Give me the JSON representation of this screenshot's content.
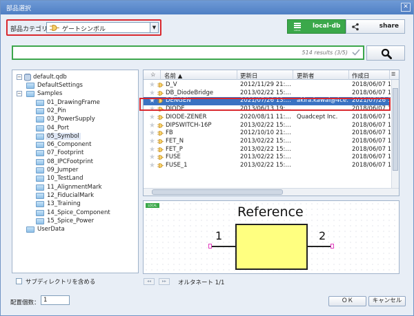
{
  "window": {
    "title": "部品選択",
    "close_glyph": "✕"
  },
  "category": {
    "label": "部品カテゴリ",
    "value": "ゲートシンボル"
  },
  "db": {
    "local_label": "local-db",
    "local_icon_tag": "LOCAL",
    "share_label": "share"
  },
  "search": {
    "value": "",
    "results": "514 results (3/5)"
  },
  "tree": {
    "root": "default.qdb",
    "items": [
      {
        "label": "DefaultSettings",
        "level": 1
      },
      {
        "label": "Samples",
        "level": 1
      },
      {
        "label": "01_DrawingFrame",
        "level": 2
      },
      {
        "label": "02_Pin",
        "level": 2
      },
      {
        "label": "03_PowerSupply",
        "level": 2
      },
      {
        "label": "04_Port",
        "level": 2
      },
      {
        "label": "05_Symbol",
        "level": 2,
        "selected": true
      },
      {
        "label": "06_Component",
        "level": 2
      },
      {
        "label": "07_Footprint",
        "level": 2
      },
      {
        "label": "08_IPCFootprint",
        "level": 2
      },
      {
        "label": "09_Jumper",
        "level": 2
      },
      {
        "label": "10_TestLand",
        "level": 2
      },
      {
        "label": "11_AlignmentMark",
        "level": 2
      },
      {
        "label": "12_FiducialMark",
        "level": 2
      },
      {
        "label": "13_Training",
        "level": 2
      },
      {
        "label": "14_Spice_Component",
        "level": 2
      },
      {
        "label": "15_Spice_Power",
        "level": 2
      },
      {
        "label": "UserData",
        "level": 1
      }
    ]
  },
  "include_subdirs": "サブディレクトリを含める",
  "grid": {
    "columns": {
      "star": "☆",
      "name": "名前 ▲",
      "updated": "更新日",
      "updater": "更新者",
      "created": "作成日"
    },
    "rows": [
      {
        "name": "D_V",
        "updated": "2012/11/29 21:…",
        "updater": "",
        "created": "2018/06/07 1"
      },
      {
        "name": "DB_DiodeBridge",
        "updated": "2013/02/22 15:…",
        "updater": "",
        "created": "2018/06/07 1"
      },
      {
        "name": "DENGEN",
        "updated": "2021/07/26 13:…",
        "updater": "akira.kawai@4ce…",
        "created": "2021/07/26 1",
        "selected": true
      },
      {
        "name": "DIODE",
        "updated": "2013/06/13 19:…",
        "updater": "",
        "created": "2018/06/07 1"
      },
      {
        "name": "DIODE-ZENER",
        "updated": "2020/08/11 11:…",
        "updater": "Quadcept Inc.",
        "created": "2018/06/07 1"
      },
      {
        "name": "DIPSWITCH-16P",
        "updated": "2013/02/22 15:…",
        "updater": "",
        "created": "2018/06/07 1"
      },
      {
        "name": "FB",
        "updated": "2012/10/10 21:…",
        "updater": "",
        "created": "2018/06/07 1"
      },
      {
        "name": "FET_N",
        "updated": "2013/02/22 15:…",
        "updater": "",
        "created": "2018/06/07 1"
      },
      {
        "name": "FET_P",
        "updated": "2013/02/22 15:…",
        "updater": "",
        "created": "2018/06/07 1"
      },
      {
        "name": "FUSE",
        "updated": "2013/02/22 15:…",
        "updater": "",
        "created": "2018/06/07 1"
      },
      {
        "name": "FUSE_1",
        "updated": "2013/02/22 15:…",
        "updater": "",
        "created": "2018/06/07 1"
      }
    ]
  },
  "preview": {
    "tag": "LOCAL",
    "reference": "Reference",
    "pin1": "1",
    "pin2": "2"
  },
  "alternate": {
    "prev": "◂◂",
    "next": "▸▸",
    "label": "オルタネート 1/1"
  },
  "quantity": {
    "label": "配置個数：",
    "value": "1"
  },
  "buttons": {
    "ok": "ＯＫ",
    "cancel": "キャンセル"
  },
  "colors": {
    "accent_red": "#d9272d",
    "local_green": "#3ba84a",
    "selection_blue": "#3a72c2"
  }
}
